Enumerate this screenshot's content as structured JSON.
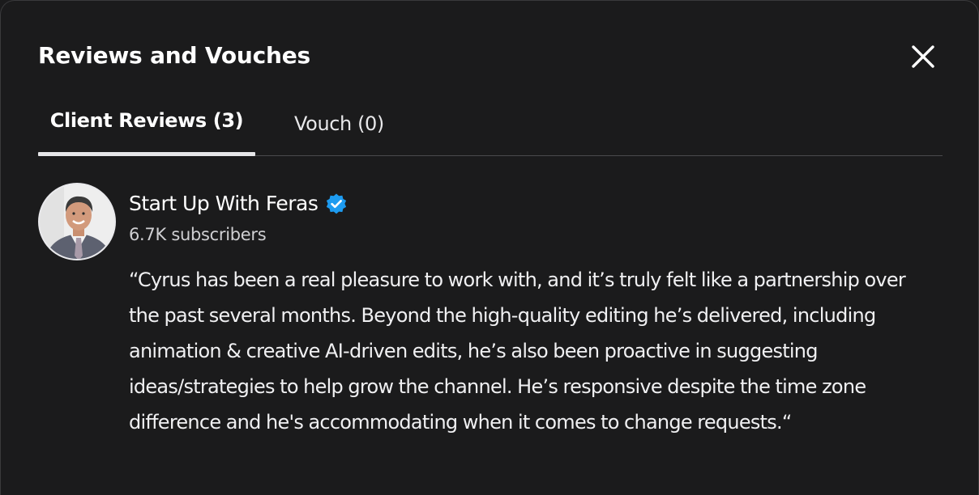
{
  "modal": {
    "title": "Reviews and Vouches",
    "close_icon": "close-icon"
  },
  "tabs": [
    {
      "label": "Client Reviews (3)",
      "active": true
    },
    {
      "label": "Vouch (0)",
      "active": false
    }
  ],
  "reviews": [
    {
      "reviewer_name": "Start Up With Feras",
      "verified": true,
      "verified_icon": "verified-badge-icon",
      "subscribers": "6.7K subscribers",
      "text": "“Cyrus has been a real pleasure to work with, and it’s truly felt like a partnership over the past several months. Beyond the high-quality editing he’s delivered, including animation & creative AI-driven edits, he’s also been proactive in suggesting ideas/strategies to help grow the channel. He’s responsive despite the time zone difference and he's accommodating when it comes to change requests.“"
    }
  ],
  "colors": {
    "background": "#1b1b1c",
    "text": "#ffffff",
    "muted_text": "#cfcfd2",
    "divider": "#4a4a4d",
    "active_tab_indicator": "#e6e6e8",
    "verified_badge": "#1d9bf0"
  }
}
